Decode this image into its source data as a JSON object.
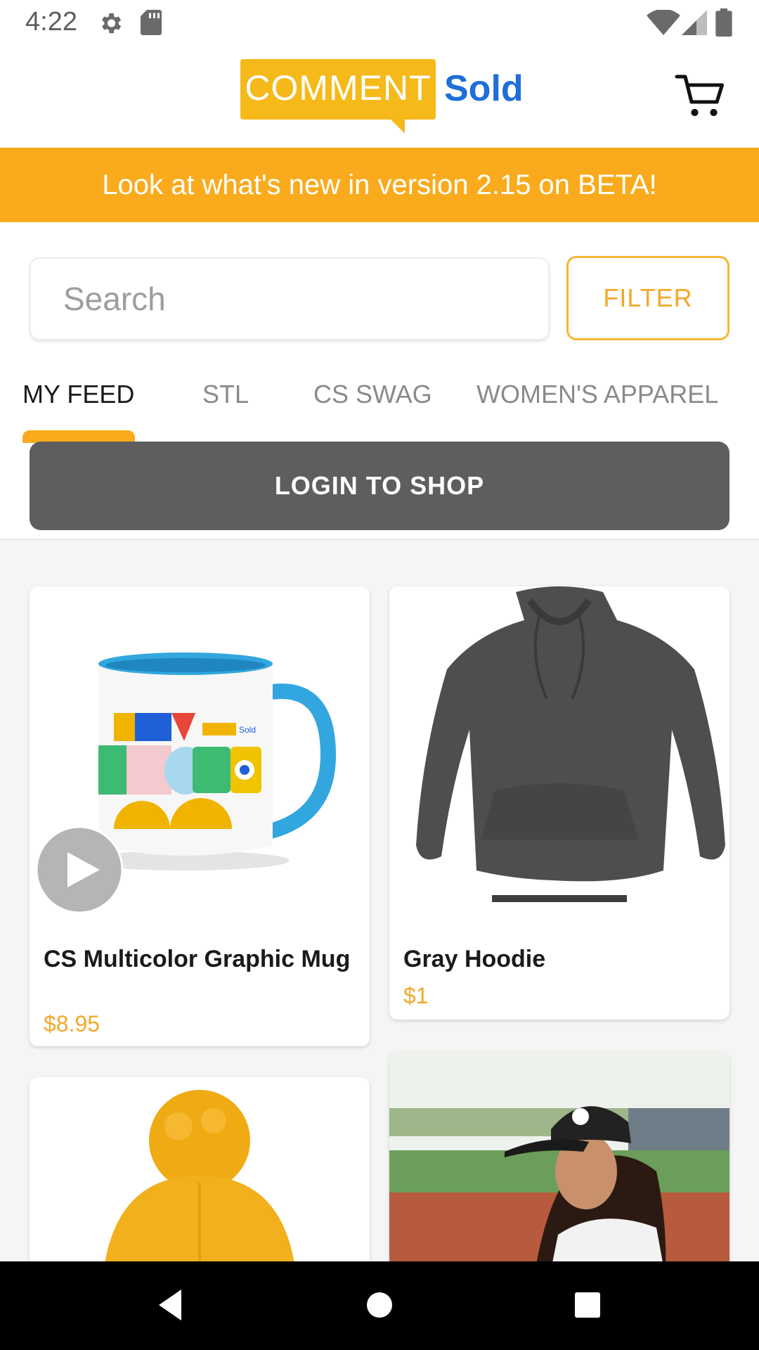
{
  "status_bar": {
    "time": "4:22",
    "icons": [
      "gear-icon",
      "sd-card-icon",
      "wifi-icon",
      "signal-icon",
      "battery-icon"
    ]
  },
  "header": {
    "logo_comment": "COMMENT",
    "logo_sold": "Sold",
    "brand_yellow": "#f6b91a",
    "brand_blue": "#1e6fd9",
    "cart_icon": "cart-icon"
  },
  "banner": {
    "text": "Look at what's new in version 2.15 on BETA!",
    "color": "#f9ab1d"
  },
  "search": {
    "placeholder": "Search",
    "filter_label": "FILTER"
  },
  "tabs": [
    {
      "label": "MY FEED",
      "active": true
    },
    {
      "label": "STL",
      "active": false
    },
    {
      "label": "CS SWAG",
      "active": false
    },
    {
      "label": "WOMEN'S APPAREL",
      "active": false
    }
  ],
  "login": {
    "label": "LOGIN TO SHOP"
  },
  "products": [
    {
      "title": "CS Multicolor Graphic Mug",
      "price": "$8.95",
      "image": "mug-image",
      "has_video": true
    },
    {
      "title": "Gray Hoodie",
      "price": "$1",
      "image": "hoodie-image",
      "has_video": false
    },
    {
      "title": "",
      "price": "",
      "image": "beanie-image",
      "has_video": false
    },
    {
      "title": "",
      "price": "",
      "image": "cap-photo-image",
      "has_video": false
    }
  ],
  "nav": {
    "icons": [
      "back-icon",
      "home-icon",
      "recents-icon"
    ]
  }
}
